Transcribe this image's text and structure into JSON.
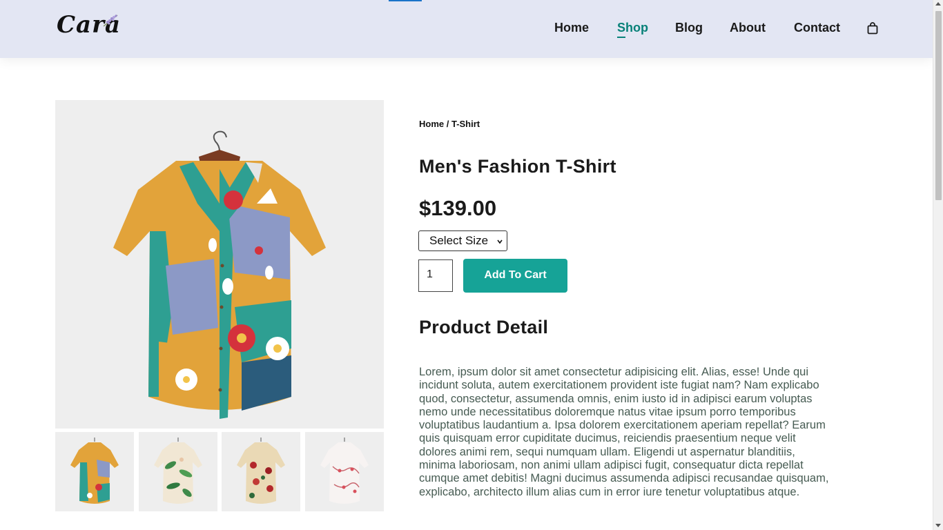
{
  "brand": {
    "logo_text": "Cara"
  },
  "nav": {
    "items": [
      {
        "label": "Home",
        "active": false
      },
      {
        "label": "Shop",
        "active": true
      },
      {
        "label": "Blog",
        "active": false
      },
      {
        "label": "About",
        "active": false
      },
      {
        "label": "Contact",
        "active": false
      }
    ],
    "cart_icon": "shopping-bag-icon"
  },
  "colors": {
    "header_bg": "#e3e6f3",
    "accent": "#088178",
    "button": "#16a397"
  },
  "product": {
    "breadcrumb": "Home / T-Shirt",
    "title": "Men's Fashion T-Shirt",
    "price": "$139.00",
    "size_select": {
      "selected": "Select Size"
    },
    "quantity": "1",
    "add_to_cart_label": "Add To Cart",
    "detail_heading": "Product Detail",
    "description": "Lorem, ipsum dolor sit amet consectetur adipisicing elit. Alias, esse! Unde qui incidunt soluta, autem exercitationem provident iste fugiat nam? Nam explicabo quod, consectetur, assumenda omnis, enim iusto id in adipisci earum voluptas nemo unde necessitatibus doloremque natus vitae ipsum porro temporibus voluptatibus laudantium a. Ipsa dolorem exercitationem aperiam repellat? Earum quis quisquam error cupiditate ducimus, reiciendis praesentium neque velit dolores animi rem, sequi numquam ullam. Eligendi ut aspernatur blanditiis, minima laboriosam, non animi ullam adipisci fugit, consequatur dicta repellat cumque amet debitis! Magni ducimus assumenda adipisci recusandae quisquam, explicabo, architecto illum alias cum in error iure tenetur voluptatibus atque."
  },
  "gallery": {
    "thumbnails": [
      {
        "name": "colorful-abstract-shirt"
      },
      {
        "name": "tropical-leaf-shirt"
      },
      {
        "name": "red-floral-shirt"
      },
      {
        "name": "pink-blossom-shirt"
      }
    ]
  }
}
